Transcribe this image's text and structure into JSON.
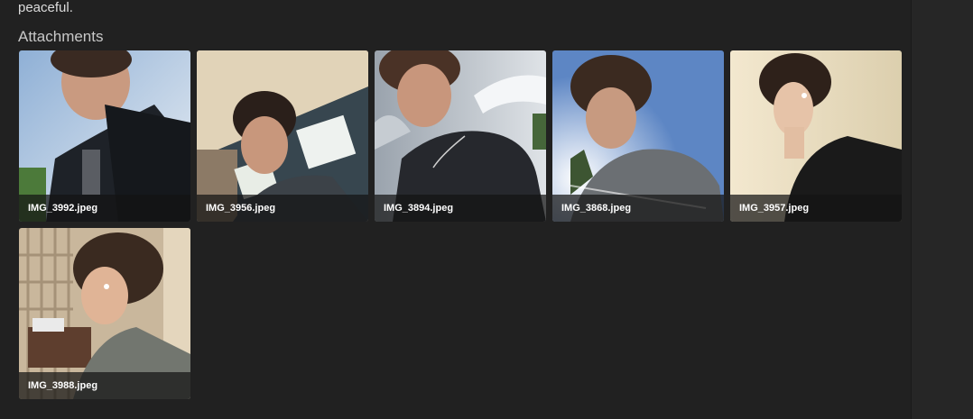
{
  "message": {
    "text_fragment": "peaceful."
  },
  "attachments": {
    "title": "Attachments",
    "items": [
      {
        "filename": "IMG_3992.jpeg",
        "scene": "outdoor-sky"
      },
      {
        "filename": "IMG_3956.jpeg",
        "scene": "indoor-ceiling-window"
      },
      {
        "filename": "IMG_3894.jpeg",
        "scene": "outdoor-cloudy-sky"
      },
      {
        "filename": "IMG_3868.jpeg",
        "scene": "outdoor-blue-sky-sun"
      },
      {
        "filename": "IMG_3957.jpeg",
        "scene": "indoor-beige-wall"
      },
      {
        "filename": "IMG_3988.jpeg",
        "scene": "indoor-curtain-profile"
      }
    ]
  },
  "colors": {
    "background": "#212121",
    "caption_overlay": "#141414",
    "caption_text": "#ffffff"
  }
}
